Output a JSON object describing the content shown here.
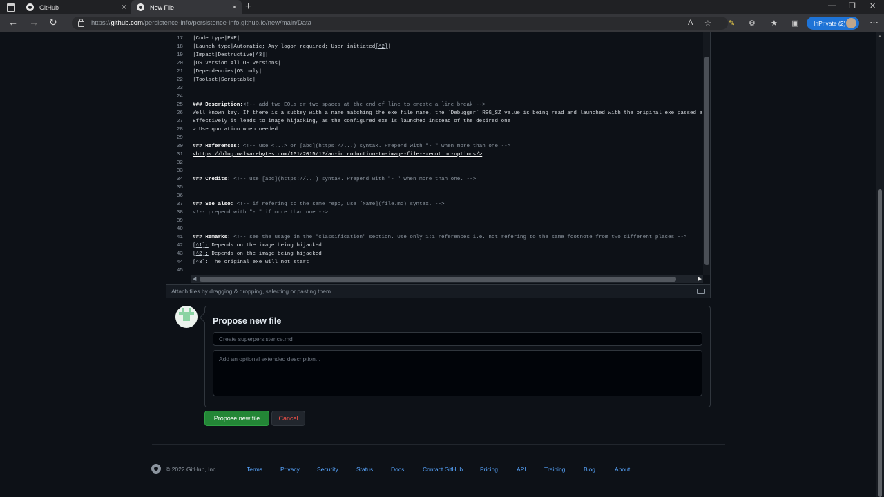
{
  "browser": {
    "tabs": [
      {
        "label": "GitHub",
        "active": false
      },
      {
        "label": "New File",
        "active": true
      }
    ],
    "url": {
      "prefix": "https://",
      "host": "github.com",
      "path": "/persistence-info/persistence-info.github.io/new/main/Data"
    },
    "inprivate_label": "InPrivate (2)"
  },
  "editor": {
    "lines": [
      {
        "n": "17",
        "text": "|Code type|EXE|"
      },
      {
        "n": "18",
        "text": "|Launch type|Automatic; Any logon required; User initiated",
        "fn": "[^2]",
        "after": "|"
      },
      {
        "n": "19",
        "text": "|Impact|Destructive",
        "fn": "[^3]",
        "after": "|"
      },
      {
        "n": "20",
        "text": "|OS Version|All OS versions|"
      },
      {
        "n": "21",
        "text": "|Dependencies|OS only|"
      },
      {
        "n": "22",
        "text": "|Toolset|Scriptable|"
      },
      {
        "n": "23",
        "text": ""
      },
      {
        "n": "24",
        "text": ""
      },
      {
        "n": "25",
        "head": "### Description:",
        "comment": "<!-- add two EOLs or two spaces at the end of line to create a line break -->"
      },
      {
        "n": "26",
        "text": "Well known key. If there is a subkey with a name matching the exe file name, the `Debugger` REG_SZ value is being read and launched with the original exe passed as para"
      },
      {
        "n": "27",
        "text": "Effectively it leads to image hijacking, as the configured exe is launched instead of the desired one."
      },
      {
        "n": "28",
        "text": "> Use quotation when needed"
      },
      {
        "n": "29",
        "text": ""
      },
      {
        "n": "30",
        "head": "### References:",
        "comment": " <!-- use <...> or [abc](https://...) syntax. Prepend with \"- \" when more than one -->"
      },
      {
        "n": "31",
        "link": "<https://blog.malwarebytes.com/101/2015/12/an-introduction-to-image-file-execution-options/>"
      },
      {
        "n": "32",
        "text": ""
      },
      {
        "n": "33",
        "text": ""
      },
      {
        "n": "34",
        "head": "### Credits:",
        "comment": " <!-- use [abc](https://...) syntax. Prepend with \"- \" when more than one. -->"
      },
      {
        "n": "35",
        "text": ""
      },
      {
        "n": "36",
        "text": ""
      },
      {
        "n": "37",
        "head": "### See also:",
        "comment": " <!-- if refering to the same repo, use [Name](file.md) syntax. -->"
      },
      {
        "n": "38",
        "cmt": "<!-- prepend with \"- \" if more than one -->"
      },
      {
        "n": "39",
        "text": ""
      },
      {
        "n": "40",
        "text": ""
      },
      {
        "n": "41",
        "head": "### Remarks:",
        "comment": " <!-- see the usage in the \"classification\" section. Use only 1:1 references i.e. not refering to the same footnote from two different places -->"
      },
      {
        "n": "42",
        "fn": "[^1]:",
        "after": " Depends on the image being hijacked"
      },
      {
        "n": "43",
        "fn": "[^2]:",
        "after": " Depends on the image being hijacked"
      },
      {
        "n": "44",
        "fn": "[^3]:",
        "after": " The original exe will not start"
      },
      {
        "n": "45",
        "text": ""
      }
    ],
    "attach_hint": "Attach files by dragging & dropping, selecting or pasting them."
  },
  "propose": {
    "title": "Propose new file",
    "commit_placeholder": "Create superpersistence.md",
    "desc_placeholder": "Add an optional extended description...",
    "submit_label": "Propose new file",
    "cancel_label": "Cancel"
  },
  "footer": {
    "copyright": "© 2022 GitHub, Inc.",
    "links": [
      {
        "label": "Terms",
        "slug": "terms"
      },
      {
        "label": "Privacy",
        "slug": "privacy"
      },
      {
        "label": "Security",
        "slug": "security"
      },
      {
        "label": "Status",
        "slug": "status"
      },
      {
        "label": "Docs",
        "slug": "docs"
      },
      {
        "label": "Contact GitHub",
        "slug": "contact-github"
      },
      {
        "label": "Pricing",
        "slug": "pricing"
      },
      {
        "label": "API",
        "slug": "api"
      },
      {
        "label": "Training",
        "slug": "training"
      },
      {
        "label": "Blog",
        "slug": "blog"
      },
      {
        "label": "About",
        "slug": "about"
      }
    ]
  },
  "colors": {
    "accent_link": "#58a6ff",
    "primary_button": "#238636",
    "danger_text": "#f85149",
    "inprivate_badge": "#1e73d6"
  }
}
